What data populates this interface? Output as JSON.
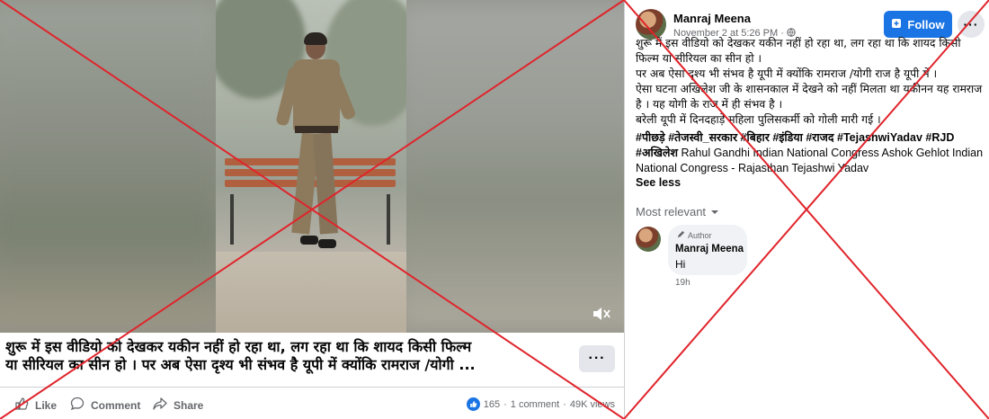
{
  "video": {
    "caption_line1": "शुरू में इस वीडियो को देखकर यकीन नहीं हो रहा था, लग रहा था कि शायद किसी फिल्म",
    "caption_line2": "या सीरियल का सीन हो । पर अब ऐसा दृश्य भी संभव है यूपी में क्योंकि रामराज /योगी ...",
    "more_label": "···"
  },
  "actions": {
    "like_label": "Like",
    "comment_label": "Comment",
    "share_label": "Share",
    "reaction_count": "165",
    "separator1": "·",
    "comment_count": "1 comment",
    "separator2": "·",
    "view_count": "49K views"
  },
  "post": {
    "author": "Manraj Meena",
    "date": "November 2 at 5:26 PM · ",
    "follow_label": "Follow",
    "more_label": "···",
    "body": [
      "शुरू में इस वीडियो को देखकर यकीन नहीं हो रहा था, लग रहा था कि शायद किसी फिल्म या सीरियल का सीन हो ।",
      "पर अब ऐसा दृश्य भी संभव है यूपी में क्योंकि रामराज /योगी राज है यूपी में ।",
      "ऐसा घटना अखिलेश जी के शासनकाल में देखने को नहीं मिलता था यकीनन यह रामराज है । यह योगी के राज में ही संभव है ।",
      "बरेली यूपी में दिनदहाड़े महिला पुलिसकर्मी को गोली मारी गई ।"
    ],
    "hashtags": "#पीछड़े #तेजस्वी_सरकार #बिहार #इंडिया #राजद #TejashwiYadav #RJD #अखिलेश",
    "mentions": "Rahul Gandhi Indian National Congress Ashok Gehlot Indian National Congress - Rajasthan Tejashwi Yadav",
    "see_less": "See less"
  },
  "comments": {
    "sort_label": "Most relevant",
    "items": [
      {
        "badge": "Author",
        "name": "Manraj Meena",
        "text": "Hi",
        "time": "19h"
      }
    ]
  },
  "colors": {
    "accent": "#1b74e4",
    "overlay_x": "#e0242b",
    "muted": "#65676b"
  },
  "icons": [
    "pencil-icon",
    "globe-icon",
    "like-icon",
    "comment-icon",
    "share-icon",
    "mute-icon",
    "chevron-down-icon",
    "follow-icon"
  ]
}
